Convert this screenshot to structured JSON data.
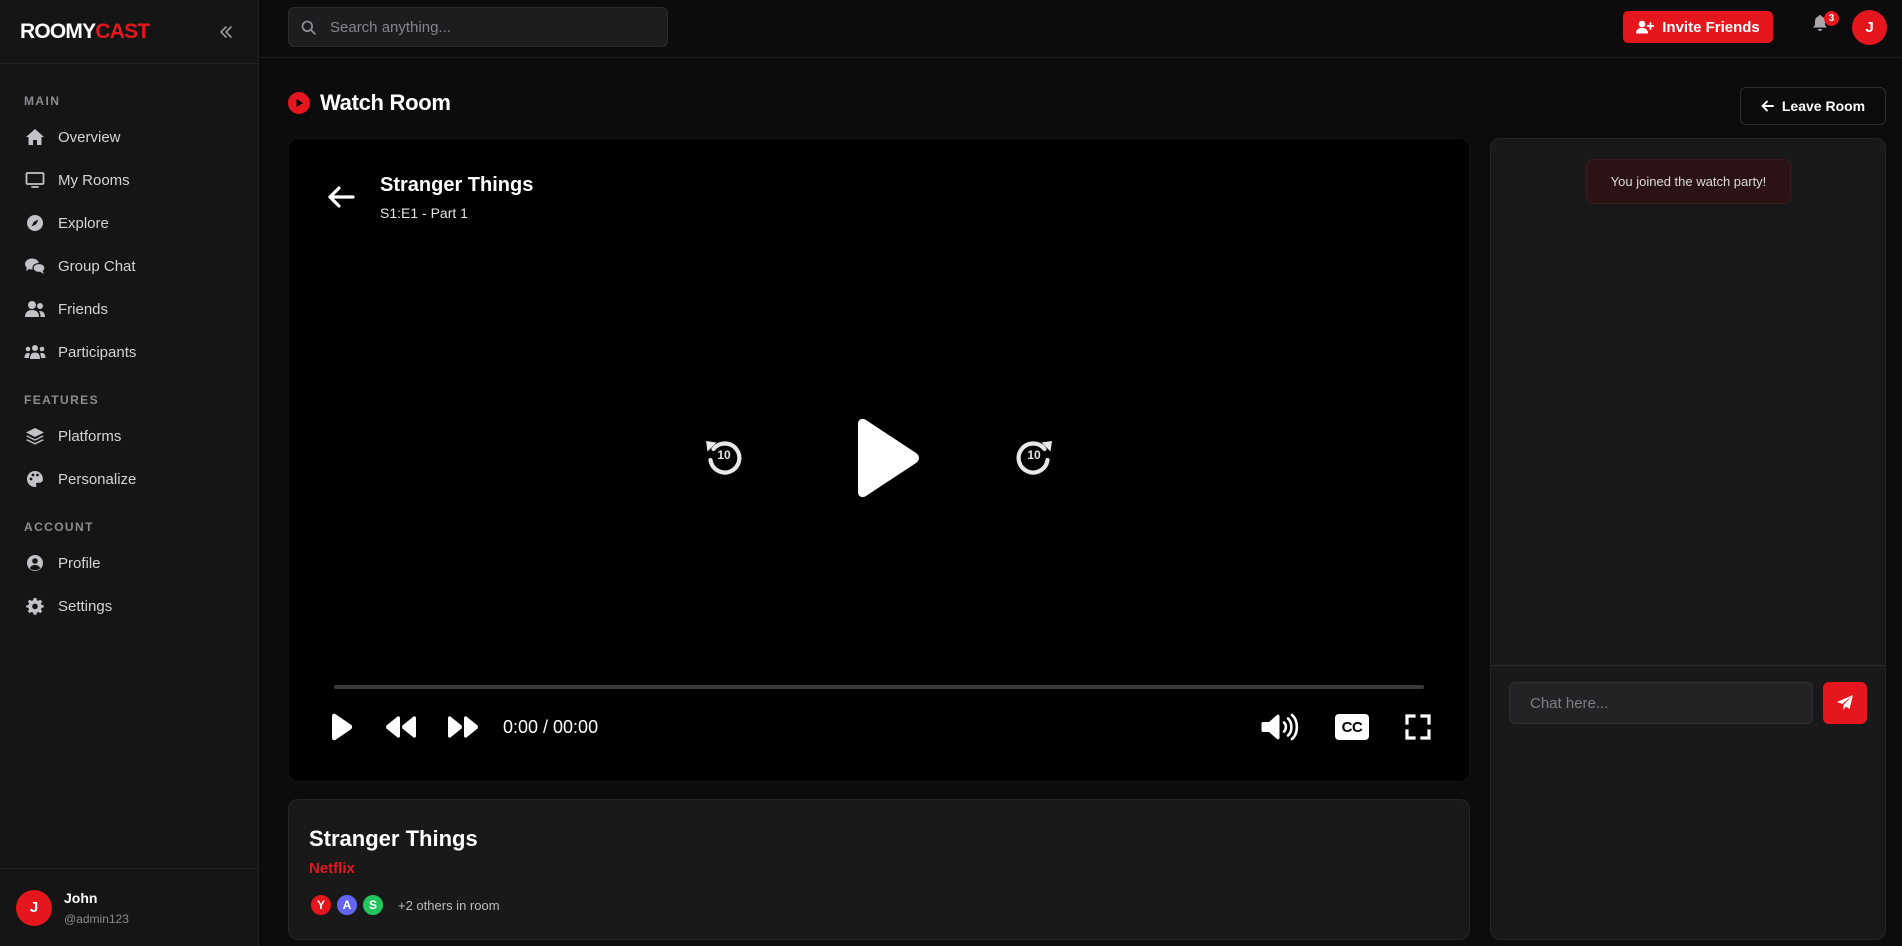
{
  "brand": {
    "part1": "ROOMY",
    "part2": "CAST"
  },
  "search": {
    "placeholder": "Search anything..."
  },
  "topbar": {
    "invite_label": "Invite Friends",
    "notification_count": "3",
    "user_initial": "J"
  },
  "sidebar": {
    "sections": [
      {
        "label": "MAIN",
        "items": [
          {
            "label": "Overview",
            "icon": "home-icon"
          },
          {
            "label": "My Rooms",
            "icon": "monitor-icon"
          },
          {
            "label": "Explore",
            "icon": "compass-icon"
          },
          {
            "label": "Group Chat",
            "icon": "comments-icon"
          },
          {
            "label": "Friends",
            "icon": "users-icon"
          },
          {
            "label": "Participants",
            "icon": "group-icon"
          }
        ]
      },
      {
        "label": "FEATURES",
        "items": [
          {
            "label": "Platforms",
            "icon": "layers-icon"
          },
          {
            "label": "Personalize",
            "icon": "palette-icon"
          }
        ]
      },
      {
        "label": "ACCOUNT",
        "items": [
          {
            "label": "Profile",
            "icon": "user-circle-icon"
          },
          {
            "label": "Settings",
            "icon": "gear-icon"
          }
        ]
      }
    ],
    "user": {
      "initial": "J",
      "name": "John",
      "handle": "@admin123"
    }
  },
  "page": {
    "title": "Watch Room",
    "leave_label": "Leave Room"
  },
  "player": {
    "title": "Stranger Things",
    "episode": "S1:E1 - Part 1",
    "skip_back_seconds": "10",
    "skip_forward_seconds": "10",
    "time_display": "0:00 / 00:00",
    "progress_percent": 0,
    "cc_label": "CC"
  },
  "info": {
    "title": "Stranger Things",
    "platform": "Netflix",
    "participants": [
      {
        "initial": "Y",
        "color": "#e5161d"
      },
      {
        "initial": "A",
        "color": "#6366f1"
      },
      {
        "initial": "S",
        "color": "#22c55e"
      }
    ],
    "others_text": "+2 others in room"
  },
  "chat": {
    "system_message": "You joined the watch party!",
    "placeholder": "Chat here..."
  },
  "colors": {
    "accent": "#e5161d",
    "background": "#0c0c0d",
    "panel": "#19191a"
  }
}
